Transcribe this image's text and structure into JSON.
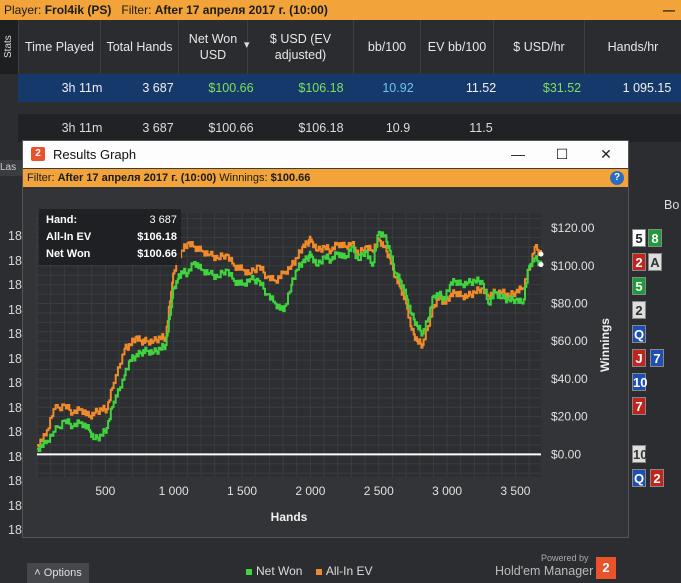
{
  "topbar": {
    "player_label": "Player:",
    "player_value": "Frol4ik (PS)",
    "filter_label": "Filter:",
    "filter_value": "After 17 апреля 2017 г. (10:00)",
    "minimize": "—"
  },
  "stats_tab": "Stats",
  "columns": [
    "Time Played",
    "Total Hands",
    "Net Won USD",
    "$ USD (EV adjusted)",
    "bb/100",
    "EV bb/100",
    "$ USD/hr",
    "Hands/hr"
  ],
  "rows": [
    [
      "3h 11m",
      "3 687",
      "$100.66",
      "$106.18",
      "10.92",
      "11.52",
      "$31.52",
      "1 095.15"
    ],
    [
      "3h 11m",
      "3 687",
      "$100.66",
      "$106.18",
      "10.9",
      "11.5",
      "",
      ""
    ]
  ],
  "last_tab": "Las",
  "bo_label": "Bo",
  "left_numbers": [
    "18",
    "18",
    "18",
    "18",
    "18",
    "18",
    "18",
    "18",
    "18",
    "18",
    "18",
    "18",
    "18"
  ],
  "cards": [
    {
      "text": "5",
      "bg": "#ffffff",
      "fg": "#222222"
    },
    {
      "text": "8",
      "bg": "#1f9a3a",
      "fg": "#ffffff"
    },
    {
      "text": "2",
      "bg": "#c0241d",
      "fg": "#ffffff"
    },
    {
      "text": "A",
      "bg": "#dddddd",
      "fg": "#333333"
    },
    {
      "text": "5",
      "bg": "#1f9a3a",
      "fg": "#ffffff"
    },
    {
      "text": "2",
      "bg": "#dddddd",
      "fg": "#333333"
    },
    {
      "text": "Q",
      "bg": "#1f4fb4",
      "fg": "#ffffff"
    },
    {
      "text": "J",
      "bg": "#c0241d",
      "fg": "#ffffff"
    },
    {
      "text": "7",
      "bg": "#1f4fb4",
      "fg": "#ffffff"
    },
    {
      "text": "10",
      "bg": "#1f4fb4",
      "fg": "#ffffff"
    },
    {
      "text": "7",
      "bg": "#c0241d",
      "fg": "#ffffff"
    },
    {
      "text": "10",
      "bg": "#dddddd",
      "fg": "#333333"
    },
    {
      "text": "Q",
      "bg": "#1f4fb4",
      "fg": "#ffffff"
    },
    {
      "text": "2",
      "bg": "#c0241d",
      "fg": "#ffffff"
    }
  ],
  "window": {
    "title": "Results Graph",
    "logo": "2",
    "filter_label": "Filter:",
    "filter_value": "After 17 апреля 2017 г. (10:00)",
    "winnings_label": "Winnings:",
    "winnings_value": "$100.66",
    "help": "?",
    "options_label": "Options",
    "powered_by": "Powered by",
    "brand": "Hold'em Manager",
    "brand_logo": "2"
  },
  "stats_box": [
    {
      "label": "Hand:",
      "value": "3 687"
    },
    {
      "label": "All-In EV",
      "value": "$106.18"
    },
    {
      "label": "Net Won",
      "value": "$100.66"
    }
  ],
  "colors": {
    "net_won": "#3fd43f",
    "all_in_ev": "#f08a2a",
    "accent": "#f2a33a",
    "selected_row": "#16396b"
  },
  "chart_data": {
    "type": "line",
    "xlabel": "Hands",
    "ylabel": "Winnings",
    "xlim": [
      0,
      3687
    ],
    "ylim": [
      -12,
      128
    ],
    "x_ticks": [
      "500",
      "1 000",
      "1 500",
      "2 000",
      "2 500",
      "3 000",
      "3 500"
    ],
    "x_tick_values": [
      500,
      1000,
      1500,
      2000,
      2500,
      3000,
      3500
    ],
    "y_ticks": [
      "$0.00",
      "$20.00",
      "$40.00",
      "$60.00",
      "$80.00",
      "$100.00",
      "$120.00"
    ],
    "y_tick_values": [
      0,
      20,
      40,
      60,
      80,
      100,
      120
    ],
    "zero_line": 0,
    "series": [
      {
        "name": "Net Won",
        "x": [
          0,
          60,
          120,
          200,
          260,
          320,
          380,
          420,
          470,
          510,
          560,
          600,
          640,
          680,
          720,
          760,
          800,
          850,
          900,
          940,
          980,
          1000,
          1030,
          1060,
          1100,
          1150,
          1200,
          1260,
          1320,
          1380,
          1440,
          1500,
          1560,
          1620,
          1680,
          1740,
          1800,
          1860,
          1900,
          1940,
          1980,
          2000,
          2050,
          2100,
          2150,
          2200,
          2250,
          2300,
          2350,
          2400,
          2450,
          2500,
          2540,
          2580,
          2620,
          2660,
          2700,
          2740,
          2780,
          2820,
          2860,
          2900,
          2940,
          2980,
          3020,
          3060,
          3100,
          3150,
          3200,
          3250,
          3300,
          3350,
          3400,
          3450,
          3500,
          3550,
          3600,
          3640,
          3687
        ],
        "y": [
          3,
          6,
          12,
          18,
          15,
          17,
          13,
          8,
          10,
          14,
          28,
          34,
          42,
          50,
          52,
          54,
          55,
          54,
          56,
          58,
          78,
          88,
          93,
          97,
          96,
          102,
          98,
          96,
          94,
          98,
          92,
          90,
          93,
          92,
          85,
          80,
          76,
          90,
          98,
          102,
          104,
          106,
          100,
          105,
          103,
          107,
          104,
          110,
          103,
          108,
          100,
          118,
          116,
          108,
          96,
          92,
          84,
          74,
          68,
          64,
          72,
          84,
          85,
          82,
          90,
          92,
          90,
          91,
          92,
          92,
          80,
          86,
          83,
          82,
          82,
          80,
          100,
          104,
          100.66
        ]
      },
      {
        "name": "All-In EV",
        "x": [
          0,
          60,
          120,
          200,
          260,
          320,
          380,
          420,
          470,
          510,
          560,
          600,
          640,
          680,
          720,
          760,
          800,
          850,
          900,
          940,
          980,
          1000,
          1030,
          1060,
          1100,
          1150,
          1200,
          1260,
          1320,
          1380,
          1440,
          1500,
          1560,
          1620,
          1680,
          1740,
          1800,
          1860,
          1900,
          1940,
          1980,
          2000,
          2050,
          2100,
          2150,
          2200,
          2250,
          2300,
          2350,
          2400,
          2450,
          2500,
          2540,
          2580,
          2620,
          2660,
          2700,
          2740,
          2780,
          2820,
          2860,
          2900,
          2940,
          2980,
          3020,
          3060,
          3100,
          3150,
          3200,
          3250,
          3300,
          3350,
          3400,
          3450,
          3500,
          3550,
          3600,
          3640,
          3687
        ],
        "y": [
          5,
          10,
          24,
          26,
          22,
          24,
          20,
          22,
          24,
          24,
          38,
          46,
          56,
          58,
          62,
          60,
          60,
          60,
          62,
          62,
          86,
          96,
          104,
          108,
          112,
          110,
          108,
          106,
          104,
          106,
          100,
          98,
          96,
          100,
          94,
          92,
          96,
          100,
          104,
          110,
          112,
          114,
          108,
          110,
          108,
          112,
          110,
          112,
          106,
          110,
          108,
          114,
          110,
          104,
          94,
          88,
          80,
          66,
          60,
          58,
          68,
          78,
          84,
          80,
          84,
          86,
          84,
          84,
          86,
          88,
          84,
          86,
          86,
          84,
          86,
          88,
          98,
          110,
          106.18
        ]
      }
    ],
    "legend": [
      "Net Won",
      "All-In EV"
    ],
    "grid": true,
    "legend_position": "bottom"
  }
}
